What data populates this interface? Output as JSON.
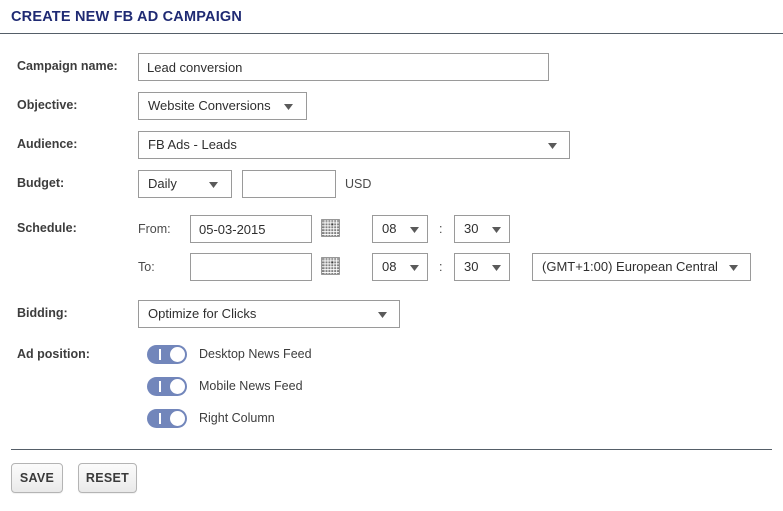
{
  "header": {
    "title": "CREATE NEW FB AD CAMPAIGN"
  },
  "form": {
    "campaign_name": {
      "label": "Campaign name:",
      "value": "Lead conversion",
      "placeholder": ""
    },
    "objective": {
      "label": "Objective:",
      "value": "Website Conversions"
    },
    "audience": {
      "label": "Audience:",
      "value": "FB Ads - Leads"
    },
    "budget": {
      "label": "Budget:",
      "type_value": "Daily",
      "amount_value": "",
      "amount_placeholder": "",
      "currency": "USD"
    },
    "schedule": {
      "label": "Schedule:",
      "from_label": "From:",
      "to_label": "To:",
      "from_date": "05-03-2015",
      "from_date_placeholder": "",
      "to_date": "",
      "to_date_placeholder": "",
      "from_hour": "08",
      "from_minute": "30",
      "to_hour": "08",
      "to_minute": "30",
      "time_separator": ":",
      "timezone": "(GMT+1:00) European Central",
      "calendar_icon": "calendar-icon"
    },
    "bidding": {
      "label": "Bidding:",
      "value": "Optimize for Clicks"
    },
    "ad_position": {
      "label": "Ad position:",
      "options": [
        {
          "label": "Desktop News Feed",
          "on": true
        },
        {
          "label": "Mobile News Feed",
          "on": true
        },
        {
          "label": "Right Column",
          "on": true
        }
      ]
    }
  },
  "actions": {
    "save_label": "SAVE",
    "reset_label": "RESET"
  },
  "colors": {
    "title": "#1f2a73",
    "label": "#3d3d3d",
    "toggle_on": "#7286bb",
    "border": "#9a9a9a",
    "rule": "#555e68"
  }
}
